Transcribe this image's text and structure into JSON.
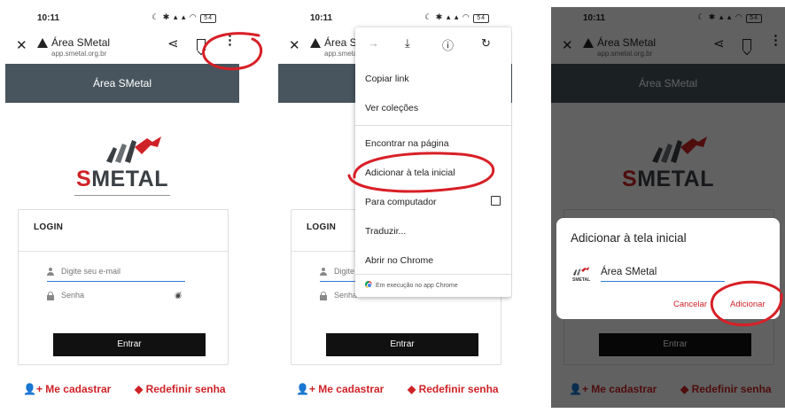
{
  "status": {
    "time": "10:11",
    "battery": "54"
  },
  "browser": {
    "title": "Área SMetal",
    "url": "app.smetal.org.br",
    "title_truncated": "Área SN",
    "url_truncated": "app.smeta"
  },
  "app": {
    "header": "Área SMetal",
    "logo": {
      "s": "S",
      "rest": "METAL"
    },
    "login_title": "LOGIN",
    "email_placeholder": "Digite seu e-mail",
    "email_placeholder_truncated": "Digite",
    "password_placeholder": "Senha",
    "password_placeholder_truncated": "Senha",
    "enter_button": "Entrar",
    "register_link": "Me cadastrar",
    "reset_link": "Redefinir senha"
  },
  "menu": {
    "items": [
      "Copiar link",
      "Ver coleções",
      "Encontrar na página",
      "Adicionar à tela inicial",
      "Para computador",
      "Traduzir...",
      "Abrir no Chrome"
    ],
    "footer": "Em execução no app Chrome"
  },
  "dialog": {
    "title": "Adicionar à tela inicial",
    "input_value": "Área SMetal",
    "icon_label": "SMETAL",
    "cancel": "Cancelar",
    "add": "Adicionar"
  },
  "colors": {
    "brand_red": "#cf2227",
    "header": "#48555e",
    "annotation": "#d81f26"
  }
}
